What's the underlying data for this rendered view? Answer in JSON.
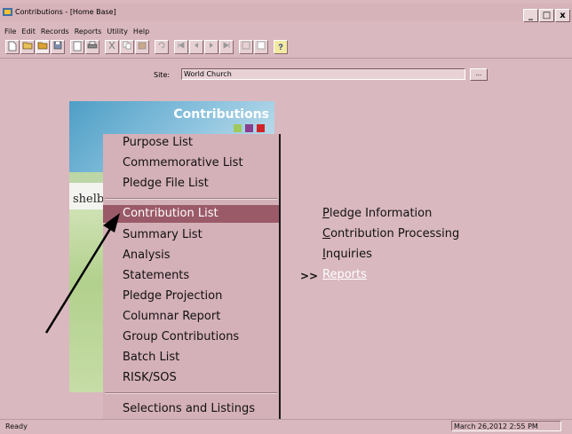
{
  "window": {
    "title": "Contributions - [Home Base]",
    "controls": [
      "_",
      "□",
      "x"
    ]
  },
  "menubar": [
    "File",
    "Edit",
    "Records",
    "Reports",
    "Utility",
    "Help"
  ],
  "toolbar": {
    "buttons": [
      "new",
      "open",
      "folder",
      "save",
      "page",
      "print",
      "cut",
      "copy",
      "paste",
      "undo",
      "first",
      "prev",
      "next",
      "last",
      "list",
      "find",
      "help"
    ],
    "help_label": "?"
  },
  "site": {
    "label": "Site:",
    "value": "World Church",
    "browse_label": "..."
  },
  "banner": {
    "title": "Contributions",
    "fragment": "shelb",
    "square_colors": [
      "#9fc95a",
      "#8a3e8e",
      "#d2232a"
    ]
  },
  "context_menu": {
    "items": [
      "Purpose List",
      "Commemorative List",
      "Pledge File List",
      "Contribution List",
      "Summary List",
      "Analysis",
      "Statements",
      "Pledge Projection",
      "Columnar Report",
      "Group Contributions",
      "Batch List",
      "RISK/SOS",
      "Selections and Listings"
    ],
    "selected": "Contribution List"
  },
  "nav_links": {
    "marker": ">>",
    "items": [
      {
        "mnemonic": "P",
        "rest": "ledge Information"
      },
      {
        "mnemonic": "C",
        "rest": "ontribution Processing"
      },
      {
        "mnemonic": "I",
        "rest": "nquiries"
      },
      {
        "mnemonic": "R",
        "rest": "eports"
      }
    ]
  },
  "status": {
    "left": "Ready",
    "right": "March 26,2012 2:55 PM"
  },
  "colors": {
    "window_bg": "#d9b8bf",
    "menu_selected": "#9b5a68",
    "banner_blue": "#4e9ec6"
  }
}
